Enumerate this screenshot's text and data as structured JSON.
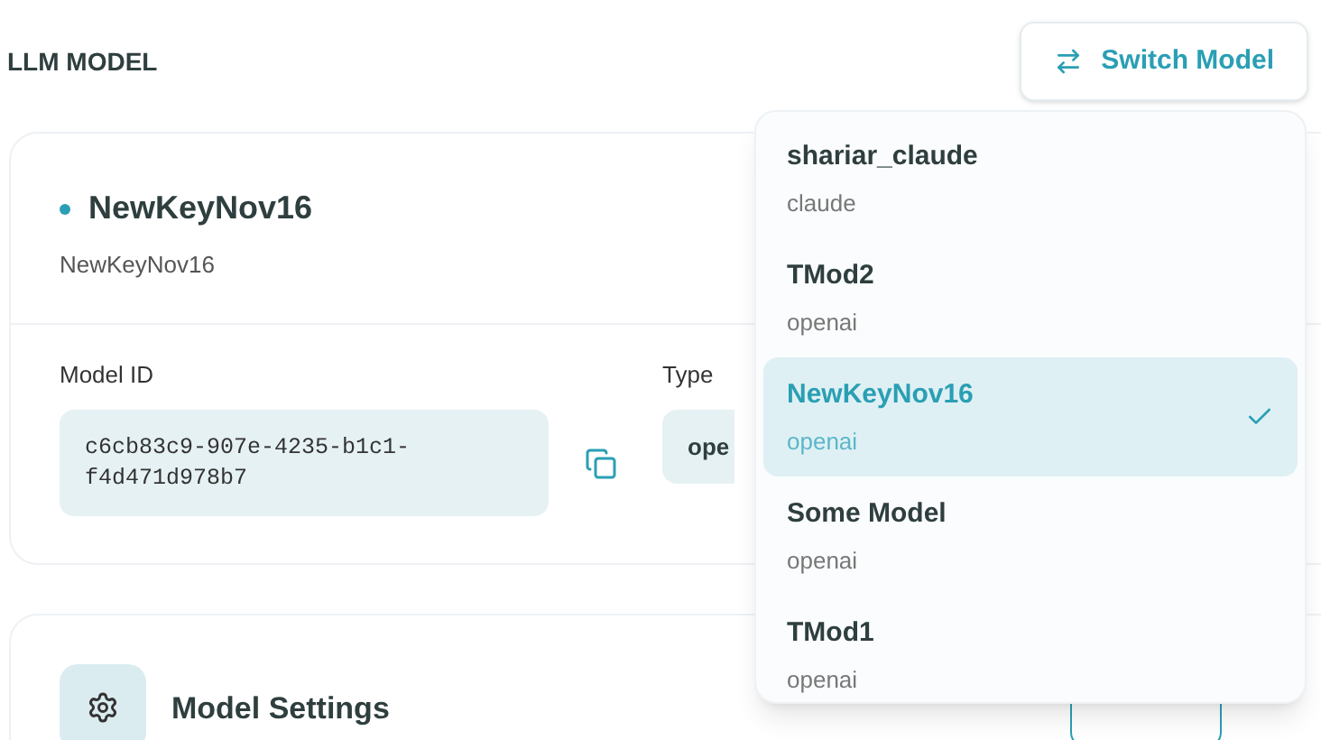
{
  "header": {
    "title": "LLM MODEL",
    "switch_button": "Switch Model"
  },
  "current_model": {
    "name": "NewKeyNov16",
    "subtitle": "NewKeyNov16",
    "model_id_label": "Model ID",
    "model_id": "c6cb83c9-907e-4235-b1c1-f4d471d978b7",
    "type_label": "Type",
    "type_value": "ope"
  },
  "settings_card": {
    "title": "Model Settings"
  },
  "dropdown": {
    "items": [
      {
        "name": "shariar_claude",
        "provider": "claude",
        "selected": false
      },
      {
        "name": "TMod2",
        "provider": "openai",
        "selected": false
      },
      {
        "name": "NewKeyNov16",
        "provider": "openai",
        "selected": true
      },
      {
        "name": "Some Model",
        "provider": "openai",
        "selected": false
      },
      {
        "name": "TMod1",
        "provider": "openai",
        "selected": false
      }
    ]
  }
}
